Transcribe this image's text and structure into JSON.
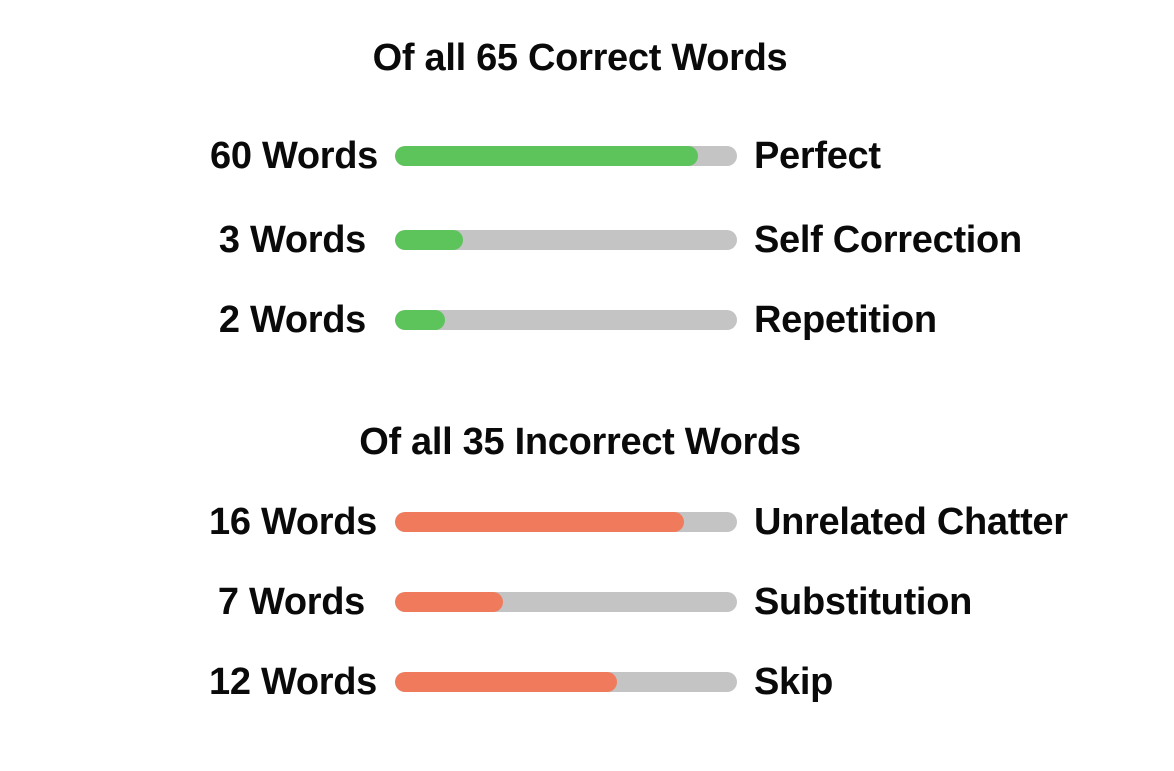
{
  "colors": {
    "correct": "#5cc45a",
    "incorrect": "#ef7b5c",
    "track": "#c4c4c4"
  },
  "correct": {
    "title": "Of all 65 Correct Words",
    "rows": [
      {
        "count": "60 Words",
        "label": "Perfect",
        "fraction": 0.885
      },
      {
        "count": "3 Words",
        "label": "Self Correction",
        "fraction": 0.2
      },
      {
        "count": "2 Words",
        "label": "Repetition",
        "fraction": 0.145
      }
    ]
  },
  "incorrect": {
    "title": "Of all 35 Incorrect Words",
    "rows": [
      {
        "count": "16 Words",
        "label": "Unrelated Chatter",
        "fraction": 0.845
      },
      {
        "count": "7 Words",
        "label": "Substitution",
        "fraction": 0.315
      },
      {
        "count": "12 Words",
        "label": "Skip",
        "fraction": 0.65
      }
    ]
  }
}
